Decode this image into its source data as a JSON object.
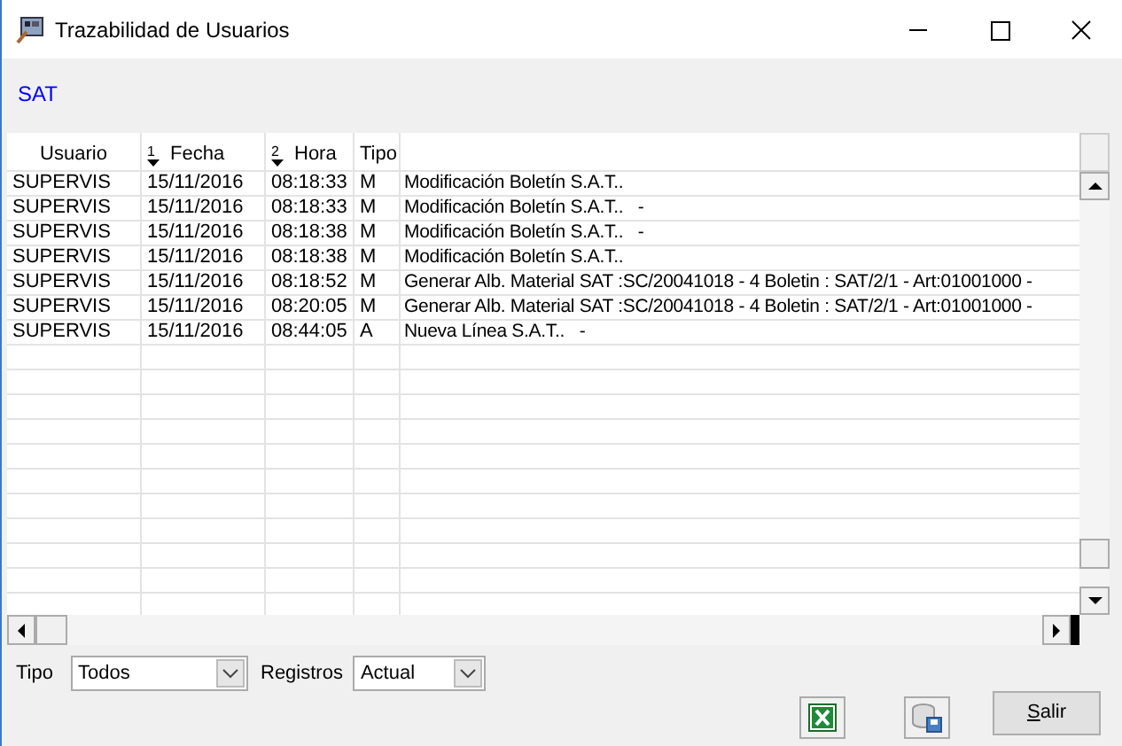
{
  "window": {
    "title": "Trazabilidad de Usuarios"
  },
  "header_label": "SAT",
  "table": {
    "columns": [
      {
        "label": "Usuario"
      },
      {
        "label": "Fecha",
        "sort_order": "1"
      },
      {
        "label": "Hora",
        "sort_order": "2"
      },
      {
        "label": "Tipo"
      },
      {}
    ],
    "rows": [
      [
        "SUPERVIS",
        "15/11/2016",
        "08:18:33",
        "M",
        "Modificación Boletín S.A.T.."
      ],
      [
        "SUPERVIS",
        "15/11/2016",
        "08:18:33",
        "M",
        "Modificación Boletín S.A.T..   -"
      ],
      [
        "SUPERVIS",
        "15/11/2016",
        "08:18:38",
        "M",
        "Modificación Boletín S.A.T..   -"
      ],
      [
        "SUPERVIS",
        "15/11/2016",
        "08:18:38",
        "M",
        "Modificación Boletín S.A.T.."
      ],
      [
        "SUPERVIS",
        "15/11/2016",
        "08:18:52",
        "M",
        "Generar Alb. Material SAT :SC/20041018 - 4 Boletin : SAT/2/1 - Art:01001000 -"
      ],
      [
        "SUPERVIS",
        "15/11/2016",
        "08:20:05",
        "M",
        "Generar Alb. Material SAT :SC/20041018 - 4 Boletin : SAT/2/1 - Art:01001000 -"
      ],
      [
        "SUPERVIS",
        "15/11/2016",
        "08:44:05",
        "A",
        "Nueva Línea S.A.T..   -"
      ]
    ]
  },
  "filters": [
    {
      "label": "Tipo",
      "value": "Todos"
    },
    {
      "label": "Registros",
      "value": "Actual"
    }
  ],
  "buttons": [
    {
      "kind": "excel"
    },
    {
      "kind": "save"
    },
    {
      "kind": "text",
      "label": "Salir"
    }
  ]
}
